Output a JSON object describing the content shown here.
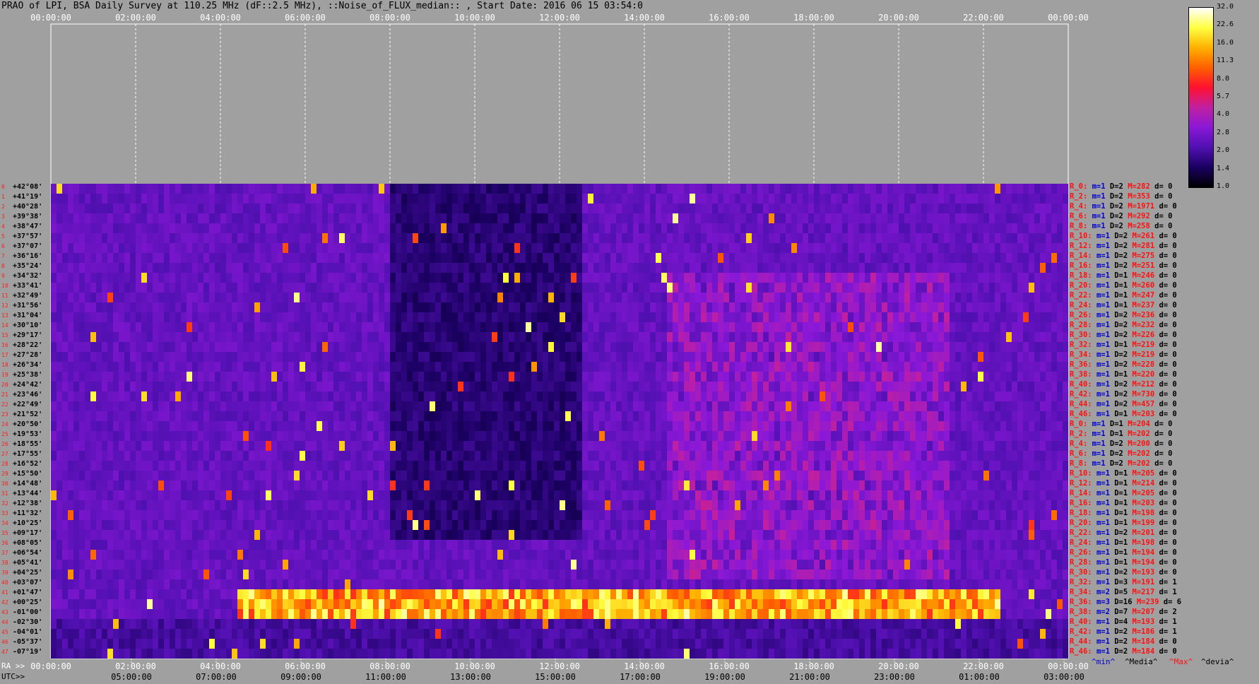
{
  "title": "PRAO of LPI, BSA Daily Survey at 110.25 MHz (dF::2.5 MHz), ::Noise_of_FLUX_median:: , Start Date: 2016 06 15 03:54:0",
  "axes": {
    "ra_tag": "RA >>",
    "utc_tag": "UTC>>"
  },
  "chart_data": {
    "type": "heatmap",
    "top_ticks": [
      "00:00:00",
      "02:00:00",
      "04:00:00",
      "06:00:00",
      "08:00:00",
      "10:00:00",
      "12:00:00",
      "14:00:00",
      "16:00:00",
      "18:00:00",
      "20:00:00",
      "22:00:00",
      "00:00:00"
    ],
    "ra_ticks": [
      "00:00:00",
      "02:00:00",
      "04:00:00",
      "06:00:00",
      "08:00:00",
      "10:00:00",
      "12:00:00",
      "14:00:00",
      "16:00:00",
      "18:00:00",
      "20:00:00",
      "22:00:00",
      "00:00:00"
    ],
    "utc_ticks": [
      "05:00:00",
      "07:00:00",
      "09:00:00",
      "11:00:00",
      "13:00:00",
      "15:00:00",
      "17:00:00",
      "19:00:00",
      "21:00:00",
      "23:00:00",
      "01:00:00",
      "03:00:00"
    ],
    "declinations": [
      "+42°08'",
      "+41°19'",
      "+40°28'",
      "+39°38'",
      "+38°47'",
      "+37°57'",
      "+37°07'",
      "+36°16'",
      "+35°24'",
      "+34°32'",
      "+33°41'",
      "+32°49'",
      "+31°56'",
      "+31°04'",
      "+30°10'",
      "+29°17'",
      "+28°22'",
      "+27°28'",
      "+26°34'",
      "+25°38'",
      "+24°42'",
      "+23°46'",
      "+22°49'",
      "+21°52'",
      "+20°50'",
      "+19°53'",
      "+18°55'",
      "+17°55'",
      "+16°52'",
      "+15°50'",
      "+14°48'",
      "+13°44'",
      "+12°38'",
      "+11°32'",
      "+10°25'",
      "+09°17'",
      "+08°05'",
      "+06°54'",
      "+05°41'",
      "+04°25'",
      "+03°07'",
      "+01°47'",
      "+00°25'",
      "-01°00'",
      "-02°30'",
      "-04°01'",
      "-05°37'",
      "-07°19'"
    ],
    "colorbar_ticks": [
      "32.0",
      "22.6",
      "16.0",
      "11.3",
      "8.0",
      "5.7",
      "4.0",
      "2.8",
      "2.0",
      "1.4",
      "1.0"
    ],
    "colorbar_colors": [
      "#000000",
      "#1a0060",
      "#5010b0",
      "#8a18d8",
      "#c020a0",
      "#ff1030",
      "#ff6000",
      "#ffb000",
      "#ffff40",
      "#ffffff"
    ],
    "stats": [
      {
        "r": "R_0:",
        "m": "m=1",
        "d": "D=2",
        "mx": "M=282",
        "dv": "d= 0"
      },
      {
        "r": "R_2:",
        "m": "m=1",
        "d": "D=2",
        "mx": "M=353",
        "dv": "d= 0"
      },
      {
        "r": "R_4:",
        "m": "m=1",
        "d": "D=2",
        "mx": "M=1971",
        "dv": "d= 0"
      },
      {
        "r": "R_6:",
        "m": "m=1",
        "d": "D=2",
        "mx": "M=292",
        "dv": "d= 0"
      },
      {
        "r": "R_8:",
        "m": "m=1",
        "d": "D=2",
        "mx": "M=258",
        "dv": "d= 0"
      },
      {
        "r": "R_10:",
        "m": "m=1",
        "d": "D=2",
        "mx": "M=261",
        "dv": "d= 0"
      },
      {
        "r": "R_12:",
        "m": "m=1",
        "d": "D=2",
        "mx": "M=281",
        "dv": "d= 0"
      },
      {
        "r": "R_14:",
        "m": "m=1",
        "d": "D=2",
        "mx": "M=275",
        "dv": "d= 0"
      },
      {
        "r": "R_16:",
        "m": "m=1",
        "d": "D=2",
        "mx": "M=251",
        "dv": "d= 0"
      },
      {
        "r": "R_18:",
        "m": "m=1",
        "d": "D=1",
        "mx": "M=246",
        "dv": "d= 0"
      },
      {
        "r": "R_20:",
        "m": "m=1",
        "d": "D=1",
        "mx": "M=260",
        "dv": "d= 0"
      },
      {
        "r": "R_22:",
        "m": "m=1",
        "d": "D=1",
        "mx": "M=247",
        "dv": "d= 0"
      },
      {
        "r": "R_24:",
        "m": "m=1",
        "d": "D=1",
        "mx": "M=237",
        "dv": "d= 0"
      },
      {
        "r": "R_26:",
        "m": "m=1",
        "d": "D=2",
        "mx": "M=236",
        "dv": "d= 0"
      },
      {
        "r": "R_28:",
        "m": "m=1",
        "d": "D=2",
        "mx": "M=232",
        "dv": "d= 0"
      },
      {
        "r": "R_30:",
        "m": "m=1",
        "d": "D=2",
        "mx": "M=226",
        "dv": "d= 0"
      },
      {
        "r": "R_32:",
        "m": "m=1",
        "d": "D=1",
        "mx": "M=219",
        "dv": "d= 0"
      },
      {
        "r": "R_34:",
        "m": "m=1",
        "d": "D=2",
        "mx": "M=219",
        "dv": "d= 0"
      },
      {
        "r": "R_36:",
        "m": "m=1",
        "d": "D=2",
        "mx": "M=228",
        "dv": "d= 0"
      },
      {
        "r": "R_38:",
        "m": "m=1",
        "d": "D=1",
        "mx": "M=220",
        "dv": "d= 0"
      },
      {
        "r": "R_40:",
        "m": "m=1",
        "d": "D=2",
        "mx": "M=212",
        "dv": "d= 0"
      },
      {
        "r": "R_42:",
        "m": "m=1",
        "d": "D=2",
        "mx": "M=730",
        "dv": "d= 0"
      },
      {
        "r": "R_44:",
        "m": "m=1",
        "d": "D=2",
        "mx": "M=457",
        "dv": "d= 0"
      },
      {
        "r": "R_46:",
        "m": "m=1",
        "d": "D=1",
        "mx": "M=203",
        "dv": "d= 0"
      },
      {
        "r": "R_0:",
        "m": "m=1",
        "d": "D=1",
        "mx": "M=204",
        "dv": "d= 0"
      },
      {
        "r": "R_2:",
        "m": "m=1",
        "d": "D=1",
        "mx": "M=202",
        "dv": "d= 0"
      },
      {
        "r": "R_4:",
        "m": "m=1",
        "d": "D=2",
        "mx": "M=200",
        "dv": "d= 0"
      },
      {
        "r": "R_6:",
        "m": "m=1",
        "d": "D=2",
        "mx": "M=202",
        "dv": "d= 0"
      },
      {
        "r": "R_8:",
        "m": "m=1",
        "d": "D=2",
        "mx": "M=202",
        "dv": "d= 0"
      },
      {
        "r": "R_10:",
        "m": "m=1",
        "d": "D=1",
        "mx": "M=205",
        "dv": "d= 0"
      },
      {
        "r": "R_12:",
        "m": "m=1",
        "d": "D=1",
        "mx": "M=214",
        "dv": "d= 0"
      },
      {
        "r": "R_14:",
        "m": "m=1",
        "d": "D=1",
        "mx": "M=205",
        "dv": "d= 0"
      },
      {
        "r": "R_16:",
        "m": "m=1",
        "d": "D=1",
        "mx": "M=203",
        "dv": "d= 0"
      },
      {
        "r": "R_18:",
        "m": "m=1",
        "d": "D=1",
        "mx": "M=198",
        "dv": "d= 0"
      },
      {
        "r": "R_20:",
        "m": "m=1",
        "d": "D=1",
        "mx": "M=199",
        "dv": "d= 0"
      },
      {
        "r": "R_22:",
        "m": "m=1",
        "d": "D=2",
        "mx": "M=201",
        "dv": "d= 0"
      },
      {
        "r": "R_24:",
        "m": "m=1",
        "d": "D=1",
        "mx": "M=198",
        "dv": "d= 0"
      },
      {
        "r": "R_26:",
        "m": "m=1",
        "d": "D=1",
        "mx": "M=194",
        "dv": "d= 0"
      },
      {
        "r": "R_28:",
        "m": "m=1",
        "d": "D=1",
        "mx": "M=194",
        "dv": "d= 0"
      },
      {
        "r": "R_30:",
        "m": "m=1",
        "d": "D=2",
        "mx": "M=193",
        "dv": "d= 0"
      },
      {
        "r": "R_32:",
        "m": "m=1",
        "d": "D=3",
        "mx": "M=191",
        "dv": "d= 1"
      },
      {
        "r": "R_34:",
        "m": "m=2",
        "d": "D=5",
        "mx": "M=217",
        "dv": "d= 1"
      },
      {
        "r": "R_36:",
        "m": "m=3",
        "d": "D=16",
        "mx": "M=239",
        "dv": "d= 6"
      },
      {
        "r": "R_38:",
        "m": "m=2",
        "d": "D=7",
        "mx": "M=207",
        "dv": "d= 2"
      },
      {
        "r": "R_40:",
        "m": "m=1",
        "d": "D=4",
        "mx": "M=193",
        "dv": "d= 1"
      },
      {
        "r": "R_42:",
        "m": "m=1",
        "d": "D=2",
        "mx": "M=186",
        "dv": "d= 1"
      },
      {
        "r": "R_44:",
        "m": "m=1",
        "d": "D=2",
        "mx": "M=184",
        "dv": "d= 0"
      },
      {
        "r": "R_46:",
        "m": "m=1",
        "d": "D=2",
        "mx": "M=184",
        "dv": "d= 0"
      }
    ],
    "legend_foot": {
      "min": "^min^",
      "media": "^Media^",
      "max": "^Max^",
      "devia": "^devia^"
    },
    "row_index_count": 48
  }
}
